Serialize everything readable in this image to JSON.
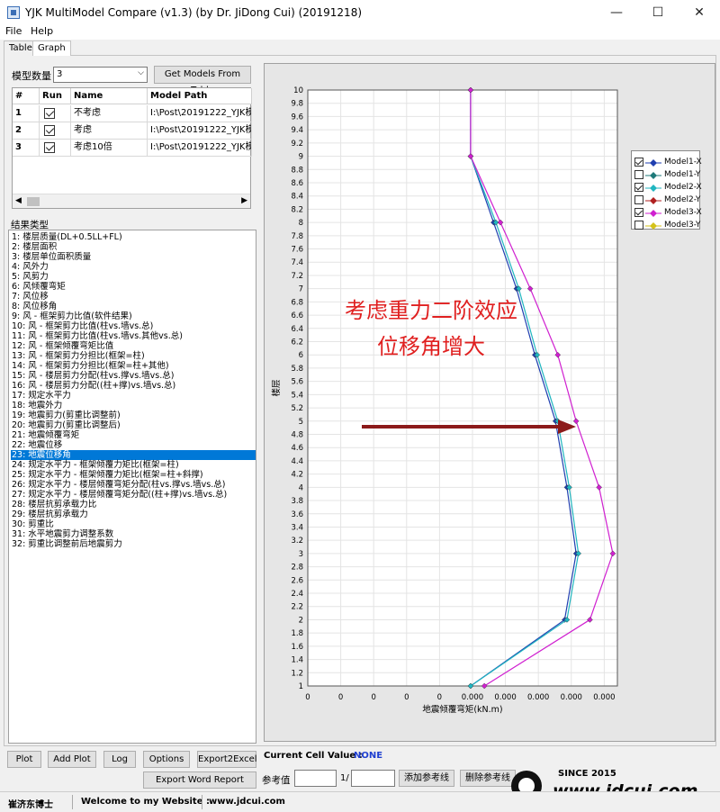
{
  "window": {
    "title": "YJK MultiModel Compare (v1.3) (by Dr. JiDong Cui) (20191218)",
    "minimize": "—",
    "maximize": "☐",
    "close": "✕"
  },
  "menu": [
    "File",
    "Help"
  ],
  "tabs": [
    "Table",
    "Graph"
  ],
  "left": {
    "model_count_label": "模型数量",
    "model_count_value": "3",
    "get_models_button": "Get Models From Table",
    "table_headers": [
      "#",
      "Run",
      "Name",
      "Model Path"
    ],
    "rows": [
      {
        "num": "1",
        "name": "不考虑",
        "path": "I:\\Post\\20191222_YJK模态"
      },
      {
        "num": "2",
        "name": "考虑",
        "path": "I:\\Post\\20191222_YJK模态"
      },
      {
        "num": "3",
        "name": "考虑10倍",
        "path": "I:\\Post\\20191222_YJK模态"
      }
    ],
    "result_type_label": "结果类型",
    "result_items": [
      "1: 楼层质量(DL+0.5LL+FL)",
      "2: 楼层面积",
      "3: 楼层单位面积质量",
      "4: 风外力",
      "5: 风剪力",
      "6: 风倾覆弯矩",
      "7: 风位移",
      "8: 风位移角",
      "9: 风 - 框架剪力比值(软件结果)",
      "10: 风 - 框架剪力比值(柱vs.墙vs.总)",
      "11: 风 - 框架剪力比值(柱vs.墙vs.其他vs.总)",
      "12: 风 - 框架倾覆弯矩比值",
      "13: 风 - 框架剪力分担比(框架=柱)",
      "14: 风 - 框架剪力分担比(框架=柱+其他)",
      "15: 风 - 楼层剪力分配(柱vs.撑vs.墙vs.总)",
      "16: 风 - 楼层剪力分配((柱+撑)vs.墙vs.总)",
      "17: 规定水平力",
      "18: 地震外力",
      "19: 地震剪力(剪重比调整前)",
      "20: 地震剪力(剪重比调整后)",
      "21: 地震倾覆弯矩",
      "22: 地震位移",
      "23: 地震位移角",
      "24: 规定水平力 - 框架倾覆力矩比(框架=柱)",
      "25: 规定水平力 - 框架倾覆力矩比(框架=柱+斜撑)",
      "26: 规定水平力 - 楼层倾覆弯矩分配(柱vs.撑vs.墙vs.总)",
      "27: 规定水平力 - 楼层倾覆弯矩分配((柱+撑)vs.墙vs.总)",
      "28: 楼层抗剪承载力比",
      "29: 楼层抗剪承载力",
      "30: 剪重比",
      "31: 水平地震剪力调整系数",
      "32: 剪重比调整前后地震剪力"
    ],
    "selected_index": 22
  },
  "chart_data": {
    "type": "line",
    "title": "",
    "xlabel": "地震倾覆弯矩(kN.m)",
    "ylabel": "楼层",
    "xlim": [
      0,
      0.00135
    ],
    "ylim": [
      1,
      10
    ],
    "x_tick_labels": [
      "0",
      "0",
      "0",
      "0",
      "0",
      "0.000",
      "0.000",
      "0.000",
      "0.000",
      "0.000"
    ],
    "y_ticks": [
      "1",
      "1.2",
      "1.4",
      "1.6",
      "1.8",
      "2",
      "2.2",
      "2.4",
      "2.6",
      "2.8",
      "3",
      "3.2",
      "3.4",
      "3.6",
      "3.8",
      "4",
      "4.2",
      "4.4",
      "4.6",
      "4.8",
      "5",
      "5.2",
      "5.4",
      "5.6",
      "5.8",
      "6",
      "6.2",
      "6.4",
      "6.6",
      "6.8",
      "7",
      "7.2",
      "7.4",
      "7.6",
      "7.8",
      "8",
      "8.2",
      "8.4",
      "8.6",
      "8.8",
      "9",
      "9.2",
      "9.4",
      "9.6",
      "9.8",
      "10"
    ],
    "grid": true,
    "legend_position": "right",
    "series": [
      {
        "name": "Model1-X",
        "color": "#1f3fb0",
        "checked": true,
        "y": [
          1,
          2,
          3,
          4,
          5,
          6,
          7,
          8,
          9,
          10
        ],
        "x": [
          0.00071,
          0.00112,
          0.00117,
          0.00113,
          0.00108,
          0.00099,
          0.00091,
          0.00081,
          0.00071,
          0.00071
        ]
      },
      {
        "name": "Model1-Y",
        "color": "#1f7a7a",
        "checked": false
      },
      {
        "name": "Model2-X",
        "color": "#20b6c0",
        "checked": true,
        "y": [
          1,
          2,
          3,
          4,
          5,
          6,
          7,
          8,
          9,
          10
        ],
        "x": [
          0.00071,
          0.00113,
          0.00118,
          0.00114,
          0.00109,
          0.001,
          0.00092,
          0.00082,
          0.00071,
          0.00071
        ]
      },
      {
        "name": "Model2-Y",
        "color": "#b02020",
        "checked": false
      },
      {
        "name": "Model3-X",
        "color": "#d020d0",
        "checked": true,
        "y": [
          1,
          2,
          3,
          4,
          5,
          6,
          7,
          8,
          9,
          10
        ],
        "x": [
          0.00077,
          0.00123,
          0.00133,
          0.00127,
          0.00117,
          0.00109,
          0.00097,
          0.00084,
          0.00071,
          0.00071
        ]
      },
      {
        "name": "Model3-Y",
        "color": "#d4c21a",
        "checked": false
      }
    ],
    "annotation": {
      "line1": "考虑重力二阶效应",
      "line2": "位移角增大",
      "color": "#e02020"
    },
    "arrow_color": "#8b1a1a"
  },
  "bottom": {
    "buttons": [
      "Plot",
      "Add Plot",
      "Log",
      "Options",
      "Export2Excel"
    ],
    "export_word": "Export Word Report",
    "current_cell_label": "Current Cell Value :",
    "current_cell_value": "NONE",
    "ref_label": "参考值",
    "ref_sep": "1/",
    "add_ref_button": "添加参考线",
    "delete_ref_button": "删除参考线"
  },
  "status": {
    "author": "崔济东博士",
    "welcome": "Welcome to my Website :",
    "url": "www.jdcui.com"
  },
  "watermark": {
    "since": "SINCE 2015",
    "site": "www.jdcui.com"
  }
}
